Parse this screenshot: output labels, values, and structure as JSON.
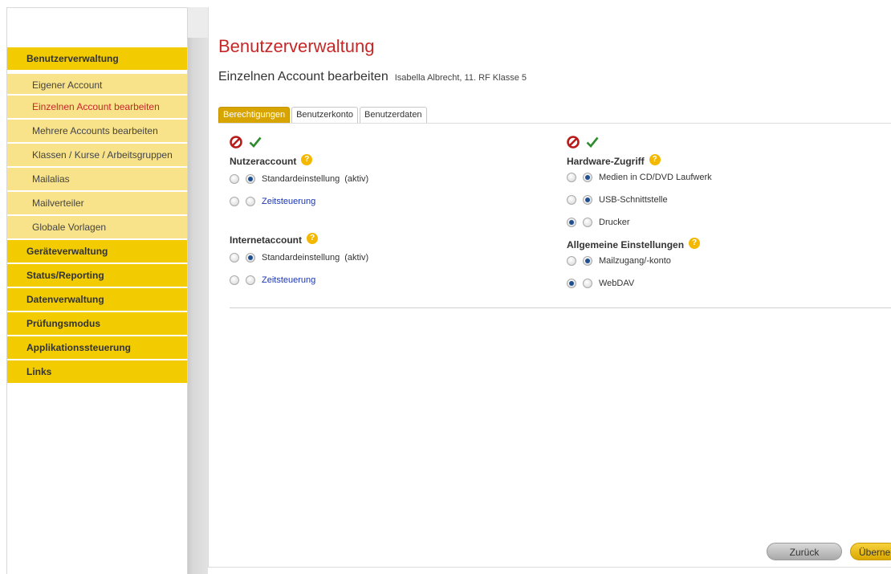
{
  "sidebar": {
    "sections": [
      {
        "label": "Benutzerverwaltung"
      },
      {
        "label": "Geräteverwaltung"
      },
      {
        "label": "Status/Reporting"
      },
      {
        "label": "Datenverwaltung"
      },
      {
        "label": "Prüfungsmodus"
      },
      {
        "label": "Applikationssteuerung"
      },
      {
        "label": "Links"
      }
    ],
    "items": [
      {
        "label": "Eigener Account"
      },
      {
        "label": "Einzelnen Account bearbeiten"
      },
      {
        "label": "Mehrere Accounts bearbeiten"
      },
      {
        "label": "Klassen / Kurse / Arbeitsgruppen"
      },
      {
        "label": "Mailalias"
      },
      {
        "label": "Mailverteiler"
      },
      {
        "label": "Globale Vorlagen"
      }
    ]
  },
  "main": {
    "title": "Benutzerverwaltung",
    "subtitle": "Einzelnen Account bearbeiten",
    "user_info": "Isabella Albrecht, 11. RF Klasse 5",
    "tabs": [
      {
        "label": "Berechtigungen"
      },
      {
        "label": "Benutzerkonto"
      },
      {
        "label": "Benutzerdaten"
      }
    ],
    "left_groups": [
      {
        "title": "Nutzeraccount",
        "options": [
          {
            "label": "Standardeinstellung",
            "note": "(aktiv)"
          },
          {
            "label": "Zeitsteuerung"
          }
        ]
      },
      {
        "title": "Internetaccount",
        "options": [
          {
            "label": "Standardeinstellung",
            "note": "(aktiv)"
          },
          {
            "label": "Zeitsteuerung"
          }
        ]
      }
    ],
    "right_groups": [
      {
        "title": "Hardware-Zugriff",
        "options": [
          {
            "label": "Medien in CD/DVD Laufwerk"
          },
          {
            "label": "USB-Schnittstelle"
          },
          {
            "label": "Drucker"
          }
        ]
      },
      {
        "title": "Allgemeine Einstellungen",
        "options": [
          {
            "label": "Mailzugang/-konto"
          },
          {
            "label": "WebDAV"
          }
        ]
      }
    ],
    "help_glyph": "?",
    "buttons": {
      "back": "Zurück",
      "apply": "Übernehmen"
    }
  },
  "colors": {
    "accent": "#f2cc00",
    "submenu": "#f8e38a",
    "active_text": "#c62828",
    "tab_active": "#d8a400",
    "link": "#1a35b8"
  }
}
